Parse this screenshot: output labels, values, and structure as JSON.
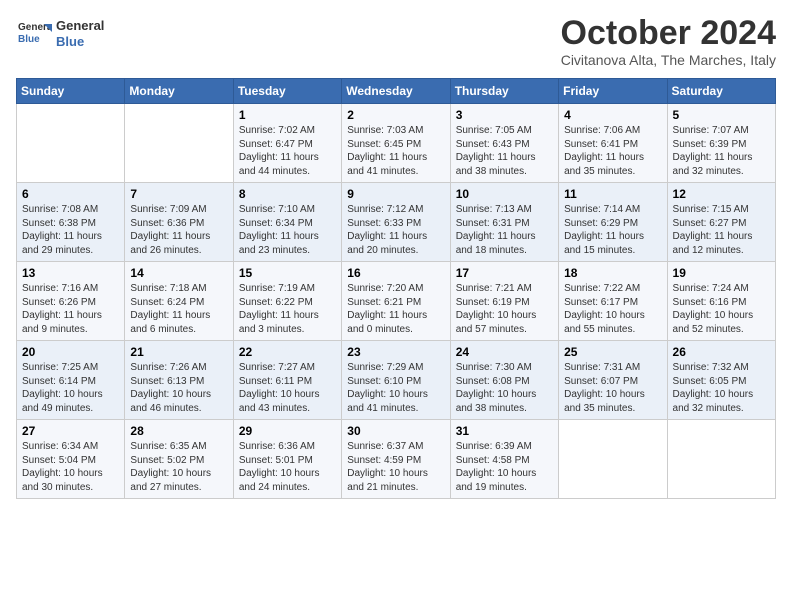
{
  "header": {
    "logo_line1": "General",
    "logo_line2": "Blue",
    "month": "October 2024",
    "location": "Civitanova Alta, The Marches, Italy"
  },
  "weekdays": [
    "Sunday",
    "Monday",
    "Tuesday",
    "Wednesday",
    "Thursday",
    "Friday",
    "Saturday"
  ],
  "weeks": [
    [
      {
        "day": "",
        "info": ""
      },
      {
        "day": "",
        "info": ""
      },
      {
        "day": "1",
        "info": "Sunrise: 7:02 AM\nSunset: 6:47 PM\nDaylight: 11 hours and 44 minutes."
      },
      {
        "day": "2",
        "info": "Sunrise: 7:03 AM\nSunset: 6:45 PM\nDaylight: 11 hours and 41 minutes."
      },
      {
        "day": "3",
        "info": "Sunrise: 7:05 AM\nSunset: 6:43 PM\nDaylight: 11 hours and 38 minutes."
      },
      {
        "day": "4",
        "info": "Sunrise: 7:06 AM\nSunset: 6:41 PM\nDaylight: 11 hours and 35 minutes."
      },
      {
        "day": "5",
        "info": "Sunrise: 7:07 AM\nSunset: 6:39 PM\nDaylight: 11 hours and 32 minutes."
      }
    ],
    [
      {
        "day": "6",
        "info": "Sunrise: 7:08 AM\nSunset: 6:38 PM\nDaylight: 11 hours and 29 minutes."
      },
      {
        "day": "7",
        "info": "Sunrise: 7:09 AM\nSunset: 6:36 PM\nDaylight: 11 hours and 26 minutes."
      },
      {
        "day": "8",
        "info": "Sunrise: 7:10 AM\nSunset: 6:34 PM\nDaylight: 11 hours and 23 minutes."
      },
      {
        "day": "9",
        "info": "Sunrise: 7:12 AM\nSunset: 6:33 PM\nDaylight: 11 hours and 20 minutes."
      },
      {
        "day": "10",
        "info": "Sunrise: 7:13 AM\nSunset: 6:31 PM\nDaylight: 11 hours and 18 minutes."
      },
      {
        "day": "11",
        "info": "Sunrise: 7:14 AM\nSunset: 6:29 PM\nDaylight: 11 hours and 15 minutes."
      },
      {
        "day": "12",
        "info": "Sunrise: 7:15 AM\nSunset: 6:27 PM\nDaylight: 11 hours and 12 minutes."
      }
    ],
    [
      {
        "day": "13",
        "info": "Sunrise: 7:16 AM\nSunset: 6:26 PM\nDaylight: 11 hours and 9 minutes."
      },
      {
        "day": "14",
        "info": "Sunrise: 7:18 AM\nSunset: 6:24 PM\nDaylight: 11 hours and 6 minutes."
      },
      {
        "day": "15",
        "info": "Sunrise: 7:19 AM\nSunset: 6:22 PM\nDaylight: 11 hours and 3 minutes."
      },
      {
        "day": "16",
        "info": "Sunrise: 7:20 AM\nSunset: 6:21 PM\nDaylight: 11 hours and 0 minutes."
      },
      {
        "day": "17",
        "info": "Sunrise: 7:21 AM\nSunset: 6:19 PM\nDaylight: 10 hours and 57 minutes."
      },
      {
        "day": "18",
        "info": "Sunrise: 7:22 AM\nSunset: 6:17 PM\nDaylight: 10 hours and 55 minutes."
      },
      {
        "day": "19",
        "info": "Sunrise: 7:24 AM\nSunset: 6:16 PM\nDaylight: 10 hours and 52 minutes."
      }
    ],
    [
      {
        "day": "20",
        "info": "Sunrise: 7:25 AM\nSunset: 6:14 PM\nDaylight: 10 hours and 49 minutes."
      },
      {
        "day": "21",
        "info": "Sunrise: 7:26 AM\nSunset: 6:13 PM\nDaylight: 10 hours and 46 minutes."
      },
      {
        "day": "22",
        "info": "Sunrise: 7:27 AM\nSunset: 6:11 PM\nDaylight: 10 hours and 43 minutes."
      },
      {
        "day": "23",
        "info": "Sunrise: 7:29 AM\nSunset: 6:10 PM\nDaylight: 10 hours and 41 minutes."
      },
      {
        "day": "24",
        "info": "Sunrise: 7:30 AM\nSunset: 6:08 PM\nDaylight: 10 hours and 38 minutes."
      },
      {
        "day": "25",
        "info": "Sunrise: 7:31 AM\nSunset: 6:07 PM\nDaylight: 10 hours and 35 minutes."
      },
      {
        "day": "26",
        "info": "Sunrise: 7:32 AM\nSunset: 6:05 PM\nDaylight: 10 hours and 32 minutes."
      }
    ],
    [
      {
        "day": "27",
        "info": "Sunrise: 6:34 AM\nSunset: 5:04 PM\nDaylight: 10 hours and 30 minutes."
      },
      {
        "day": "28",
        "info": "Sunrise: 6:35 AM\nSunset: 5:02 PM\nDaylight: 10 hours and 27 minutes."
      },
      {
        "day": "29",
        "info": "Sunrise: 6:36 AM\nSunset: 5:01 PM\nDaylight: 10 hours and 24 minutes."
      },
      {
        "day": "30",
        "info": "Sunrise: 6:37 AM\nSunset: 4:59 PM\nDaylight: 10 hours and 21 minutes."
      },
      {
        "day": "31",
        "info": "Sunrise: 6:39 AM\nSunset: 4:58 PM\nDaylight: 10 hours and 19 minutes."
      },
      {
        "day": "",
        "info": ""
      },
      {
        "day": "",
        "info": ""
      }
    ]
  ]
}
